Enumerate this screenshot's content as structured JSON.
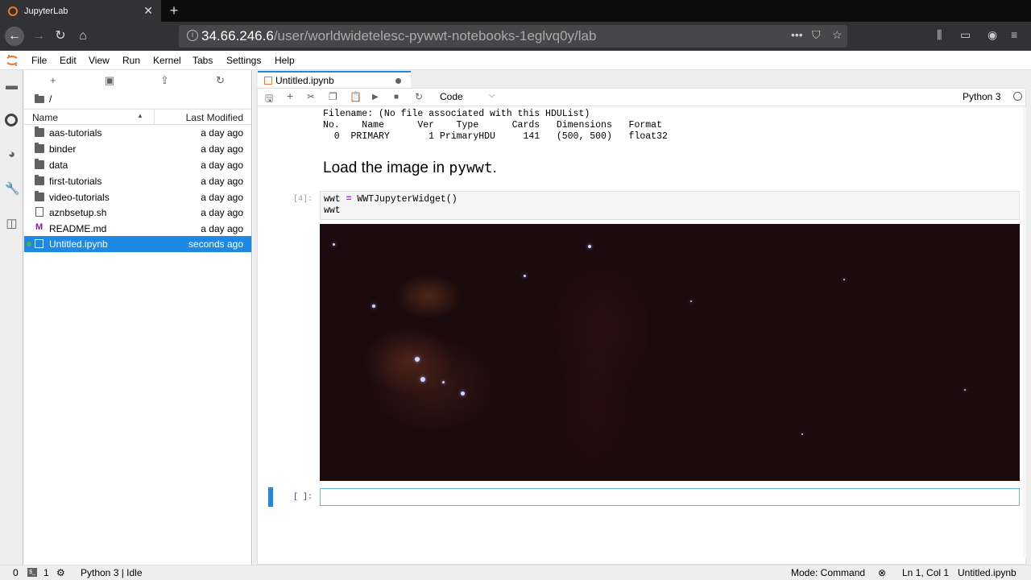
{
  "browser": {
    "tab_title": "JupyterLab",
    "url_host": "34.66.246.6",
    "url_path": "/user/worldwidetelesc-pywwt-notebooks-1eglvq0y/lab"
  },
  "menubar": {
    "items": [
      "File",
      "Edit",
      "View",
      "Run",
      "Kernel",
      "Tabs",
      "Settings",
      "Help"
    ]
  },
  "filebrowser": {
    "breadcrumb": "/",
    "col_name": "Name",
    "col_modified": "Last Modified",
    "files": [
      {
        "name": "aas-tutorials",
        "modified": "a day ago",
        "type": "folder"
      },
      {
        "name": "binder",
        "modified": "a day ago",
        "type": "folder"
      },
      {
        "name": "data",
        "modified": "a day ago",
        "type": "folder"
      },
      {
        "name": "first-tutorials",
        "modified": "a day ago",
        "type": "folder"
      },
      {
        "name": "video-tutorials",
        "modified": "a day ago",
        "type": "folder"
      },
      {
        "name": "aznbsetup.sh",
        "modified": "a day ago",
        "type": "file"
      },
      {
        "name": "README.md",
        "modified": "a day ago",
        "type": "markdown"
      },
      {
        "name": "Untitled.ipynb",
        "modified": "seconds ago",
        "type": "notebook"
      }
    ]
  },
  "notebook": {
    "tab_title": "Untitled.ipynb",
    "cell_type": "Code",
    "kernel": "Python 3",
    "output_lines": [
      "Filename: (No file associated with this HDUList)",
      "No.    Name      Ver    Type      Cards   Dimensions   Format",
      "  0  PRIMARY       1 PrimaryHDU     141   (500, 500)   float32"
    ],
    "markdown_prefix": "Load the image in ",
    "markdown_code": "pywwt",
    "markdown_suffix": ".",
    "cell4_prompt": "[4]:",
    "cell4_line1_a": "wwt ",
    "cell4_line1_op": "=",
    "cell4_line1_b": " WWTJupyterWidget()",
    "cell4_line2": "wwt",
    "empty_prompt": "[ ]:"
  },
  "statusbar": {
    "terminals": "0",
    "kernels": "1",
    "kernel_status": "Python 3 | Idle",
    "mode": "Mode: Command",
    "position": "Ln 1, Col 1",
    "filename": "Untitled.ipynb"
  }
}
